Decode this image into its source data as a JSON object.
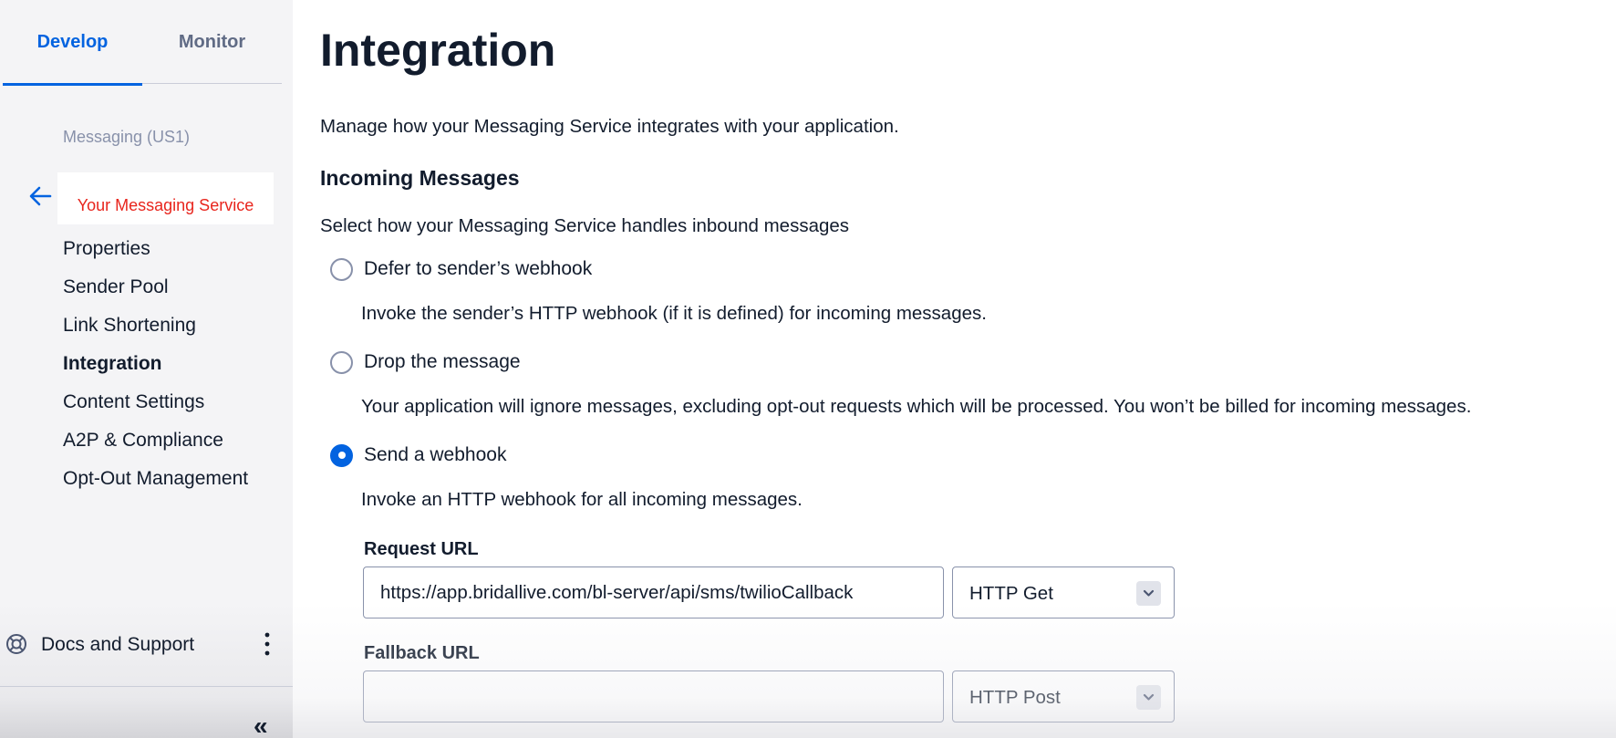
{
  "sidebar": {
    "tabs": [
      {
        "label": "Develop",
        "active": true
      },
      {
        "label": "Monitor",
        "active": false
      }
    ],
    "service_label": "Messaging (US1)",
    "service_name": "Your Messaging Service",
    "nav_items": [
      {
        "label": "Properties"
      },
      {
        "label": "Sender Pool"
      },
      {
        "label": "Link Shortening"
      },
      {
        "label": "Integration",
        "active": true
      },
      {
        "label": "Content Settings"
      },
      {
        "label": "A2P & Compliance"
      },
      {
        "label": "Opt-Out Management"
      }
    ],
    "footer": {
      "docs_label": "Docs and Support",
      "collapse_label": "«"
    }
  },
  "main": {
    "title": "Integration",
    "intro": "Manage how your Messaging Service integrates with your application.",
    "incoming": {
      "title": "Incoming Messages",
      "description": "Select how your Messaging Service handles inbound messages",
      "options": [
        {
          "label": "Defer to sender’s webhook",
          "help": "Invoke the sender’s HTTP webhook (if it is defined) for incoming messages.",
          "checked": false
        },
        {
          "label": "Drop the message",
          "help": "Your application will ignore messages, excluding opt-out requests which will be processed. You won’t be billed for incoming messages.",
          "checked": false
        },
        {
          "label": "Send a webhook",
          "help": "Invoke an HTTP webhook for all incoming messages.",
          "checked": true
        }
      ],
      "request_url": {
        "label": "Request URL",
        "value": "https://app.bridallive.com/bl-server/api/sms/twilioCallback",
        "method": "HTTP Get"
      },
      "fallback_url": {
        "label": "Fallback URL",
        "value": "",
        "method": "HTTP Post"
      }
    }
  },
  "colors": {
    "accent": "#0263e0",
    "text": "#121c2d",
    "muted": "#606b85",
    "sidebar_bg": "#f4f4f6",
    "redaction_text": "#e8251d"
  },
  "icons": {
    "back": "arrow-left-icon",
    "docs": "lifebuoy-icon",
    "more": "kebab-icon",
    "select": "chevron-down-icon"
  }
}
